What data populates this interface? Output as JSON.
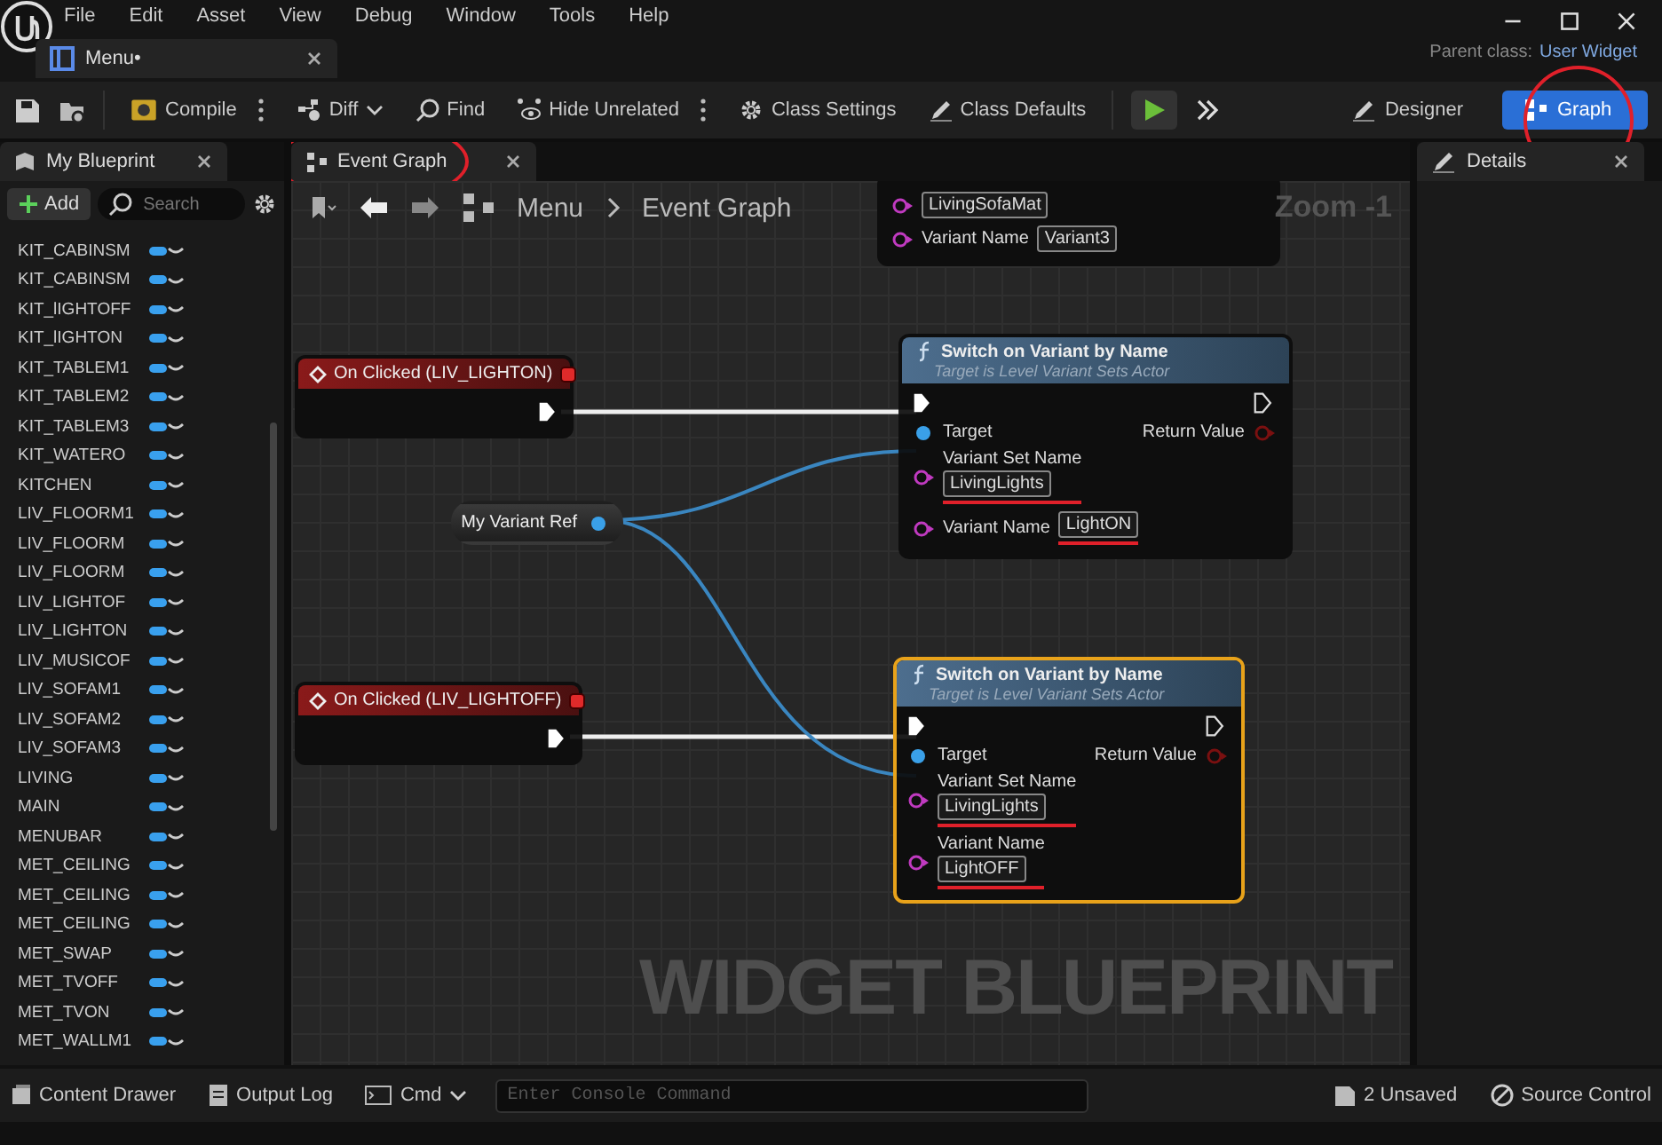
{
  "menu": [
    "File",
    "Edit",
    "Asset",
    "View",
    "Debug",
    "Window",
    "Tools",
    "Help"
  ],
  "document_tab": {
    "label": "Menu•"
  },
  "parent_class": {
    "label": "Parent class:",
    "value": "User Widget"
  },
  "toolbar": [
    {
      "label": "Compile",
      "more": true
    },
    {
      "label": "Diff",
      "dropdown": true
    },
    {
      "label": "Find"
    },
    {
      "label": "Hide Unrelated",
      "more": true
    },
    {
      "label": "Class Settings"
    },
    {
      "label": "Class Defaults"
    }
  ],
  "modes": [
    {
      "label": "Designer",
      "selected": false,
      "circled": false
    },
    {
      "label": "Graph",
      "selected": true,
      "circled": true
    }
  ],
  "my_blueprint": {
    "tab": {
      "label": "My Blueprint",
      "circled": false
    },
    "add_label": "Add",
    "search": {
      "placeholder": "Search"
    },
    "variables": [
      {
        "name": "KIT_CABINSM"
      },
      {
        "name": "KIT_CABINSM"
      },
      {
        "name": "KIT_lIGHTOFF"
      },
      {
        "name": "KIT_lIGHTON"
      },
      {
        "name": "KIT_TABLEM1"
      },
      {
        "name": "KIT_TABLEM2"
      },
      {
        "name": "KIT_TABLEM3"
      },
      {
        "name": "KIT_WATERO"
      },
      {
        "name": "KITCHEN"
      },
      {
        "name": "LIV_FLOORM1"
      },
      {
        "name": "LIV_FLOORM"
      },
      {
        "name": "LIV_FLOORM"
      },
      {
        "name": "LIV_LIGHTOF"
      },
      {
        "name": "LIV_LIGHTON"
      },
      {
        "name": "LIV_MUSICOF"
      },
      {
        "name": "LIV_SOFAM1"
      },
      {
        "name": "LIV_SOFAM2"
      },
      {
        "name": "LIV_SOFAM3"
      },
      {
        "name": "LIVING"
      },
      {
        "name": "MAIN"
      },
      {
        "name": "MENUBAR"
      },
      {
        "name": "MET_CEILING"
      },
      {
        "name": "MET_CEILING"
      },
      {
        "name": "MET_CEILING"
      },
      {
        "name": "MET_SWAP"
      },
      {
        "name": "MET_TVOFF"
      },
      {
        "name": "MET_TVON"
      },
      {
        "name": "MET_WALLM1"
      }
    ]
  },
  "event_graph": {
    "tab": {
      "label": "Event Graph",
      "circled": true
    },
    "breadcrumb": [
      "Menu",
      "Event Graph"
    ],
    "zoom": "Zoom -1",
    "nodes": [
      {
        "kind": "fragment",
        "pins": [
          {
            "kind": "name",
            "value": "LivingSofaMat"
          },
          {
            "kind": "name",
            "label": "Variant Name",
            "value": "Variant3",
            "inline": true
          }
        ]
      },
      {
        "kind": "event",
        "title": "On Clicked (LIV_LIGHTON)"
      },
      {
        "kind": "variable",
        "title": "My Variant Ref"
      },
      {
        "kind": "function",
        "title": "Switch on Variant by Name",
        "subtitle": "Target is Level Variant Sets Actor",
        "selected": false,
        "output": "Return Value",
        "pins": [
          {
            "kind": "object",
            "label": "Target"
          },
          {
            "kind": "name",
            "label": "Variant Set Name",
            "value": "LivingLights",
            "inline": false,
            "underlined": true
          },
          {
            "kind": "name",
            "label": "Variant Name",
            "value": "LightON",
            "inline": true,
            "underlined": true
          }
        ]
      },
      {
        "kind": "event",
        "title": "On Clicked (LIV_LIGHTOFF)"
      },
      {
        "kind": "function",
        "title": "Switch on Variant by Name",
        "subtitle": "Target is Level Variant Sets Actor",
        "selected": true,
        "output": "Return Value",
        "pins": [
          {
            "kind": "object",
            "label": "Target"
          },
          {
            "kind": "name",
            "label": "Variant Set Name",
            "value": "LivingLights",
            "inline": false,
            "underlined": true
          },
          {
            "kind": "name",
            "label": "Variant Name",
            "value": "LightOFF",
            "inline": false,
            "underlined": true
          }
        ]
      }
    ],
    "watermark": "WIDGET BLUEPRINT"
  },
  "details": {
    "tab": {
      "label": "Details"
    }
  },
  "status_bar": {
    "content_drawer": "Content Drawer",
    "output_log": "Output Log",
    "cmd": "Cmd",
    "console": {
      "placeholder": "Enter Console Command"
    },
    "unsaved": "2 Unsaved",
    "source_control": "Source Control"
  }
}
